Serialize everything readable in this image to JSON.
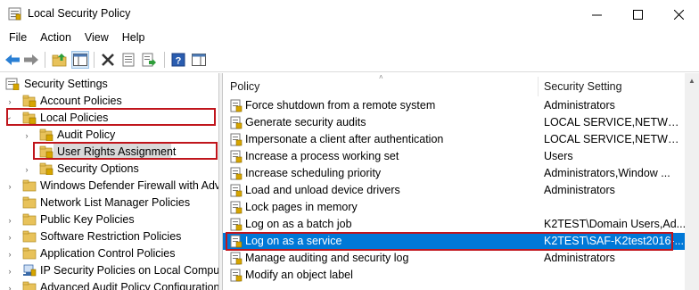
{
  "window": {
    "title": "Local Security Policy",
    "controls": {
      "minimize": "—",
      "maximize": "☐",
      "close": "✕"
    }
  },
  "menu": [
    "File",
    "Action",
    "View",
    "Help"
  ],
  "toolbar": {
    "buttons": [
      "back-arrow-icon",
      "forward-arrow-icon",
      "up-folder-icon",
      "show-tree-icon",
      "delete-icon",
      "properties-icon",
      "export-list-icon",
      "help-icon",
      "console-tree-icon"
    ]
  },
  "tree": {
    "root": "Security Settings",
    "items": [
      {
        "label": "Account Policies",
        "expanded": false,
        "level": 1
      },
      {
        "label": "Local Policies",
        "expanded": true,
        "level": 1
      },
      {
        "label": "Audit Policy",
        "expanded": false,
        "level": 2
      },
      {
        "label": "User Rights Assignment",
        "expanded": false,
        "level": 2,
        "selected": true
      },
      {
        "label": "Security Options",
        "expanded": false,
        "level": 2
      },
      {
        "label": "Windows Defender Firewall with Advan",
        "expanded": false,
        "level": 1
      },
      {
        "label": "Network List Manager Policies",
        "expanded": false,
        "level": 1
      },
      {
        "label": "Public Key Policies",
        "expanded": false,
        "level": 1
      },
      {
        "label": "Software Restriction Policies",
        "expanded": false,
        "level": 1
      },
      {
        "label": "Application Control Policies",
        "expanded": false,
        "level": 1
      },
      {
        "label": "IP Security Policies on Local Computer",
        "expanded": false,
        "level": 1
      },
      {
        "label": "Advanced Audit Policy Configuration",
        "expanded": false,
        "level": 1
      }
    ]
  },
  "list": {
    "columns": {
      "policy": "Policy",
      "setting": "Security Setting"
    },
    "rows": [
      {
        "policy": "Force shutdown from a remote system",
        "setting": "Administrators"
      },
      {
        "policy": "Generate security audits",
        "setting": "LOCAL SERVICE,NETWOR..."
      },
      {
        "policy": "Impersonate a client after authentication",
        "setting": "LOCAL SERVICE,NETWOR..."
      },
      {
        "policy": "Increase a process working set",
        "setting": "Users"
      },
      {
        "policy": "Increase scheduling priority",
        "setting": "Administrators,Window ..."
      },
      {
        "policy": "Load and unload device drivers",
        "setting": "Administrators"
      },
      {
        "policy": "Lock pages in memory",
        "setting": ""
      },
      {
        "policy": "Log on as a batch job",
        "setting": "K2TEST\\Domain Users,Ad..."
      },
      {
        "policy": "Log on as a service",
        "setting": "K2TEST\\SAF-K2test2016-...",
        "selected": true
      },
      {
        "policy": "Manage auditing and security log",
        "setting": "Administrators"
      },
      {
        "policy": "Modify an object label",
        "setting": ""
      }
    ]
  },
  "colors": {
    "selection": "#0078d7",
    "highlight_box": "#c0151c",
    "tree_selected": "#d9d9d9"
  }
}
